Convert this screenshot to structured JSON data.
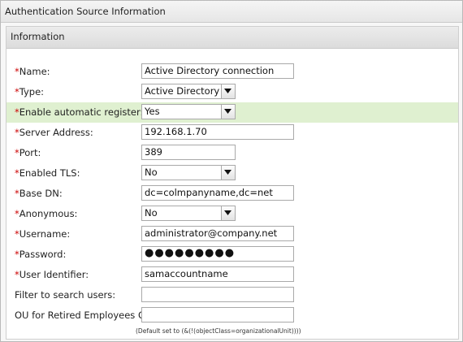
{
  "panel": {
    "title": "Authentication Source Information"
  },
  "section": {
    "title": "Information"
  },
  "required_mark": "*",
  "fields": {
    "name": {
      "label": "Name:",
      "value": "Active Directory connection"
    },
    "type": {
      "label": "Type:",
      "value": "Active Directory"
    },
    "auto_register": {
      "label": "Enable automatic register:",
      "value": "Yes"
    },
    "server": {
      "label": "Server Address:",
      "value": "192.168.1.70"
    },
    "port": {
      "label": "Port:",
      "value": "389"
    },
    "tls": {
      "label": "Enabled TLS:",
      "value": "No"
    },
    "base_dn": {
      "label": "Base DN:",
      "value": "dc=colmpanyname,dc=net"
    },
    "anonymous": {
      "label": "Anonymous:",
      "value": "No"
    },
    "username": {
      "label": "Username:",
      "value": "administrator@company.net"
    },
    "password": {
      "label": "Password:",
      "value": "●●●●●●●●●"
    },
    "user_identifier": {
      "label": "User Identifier:",
      "value": "samaccountname"
    },
    "filter": {
      "label": "Filter to search users:",
      "value": ""
    },
    "ou_retired": {
      "label": "OU for Retired Employees OU:",
      "value": ""
    }
  },
  "ou_hint": "(Default set to (&(!(objectClass=organizationalUnit))))",
  "colors": {
    "required": "#cc0000",
    "highlight_row": "#dff0d0"
  }
}
